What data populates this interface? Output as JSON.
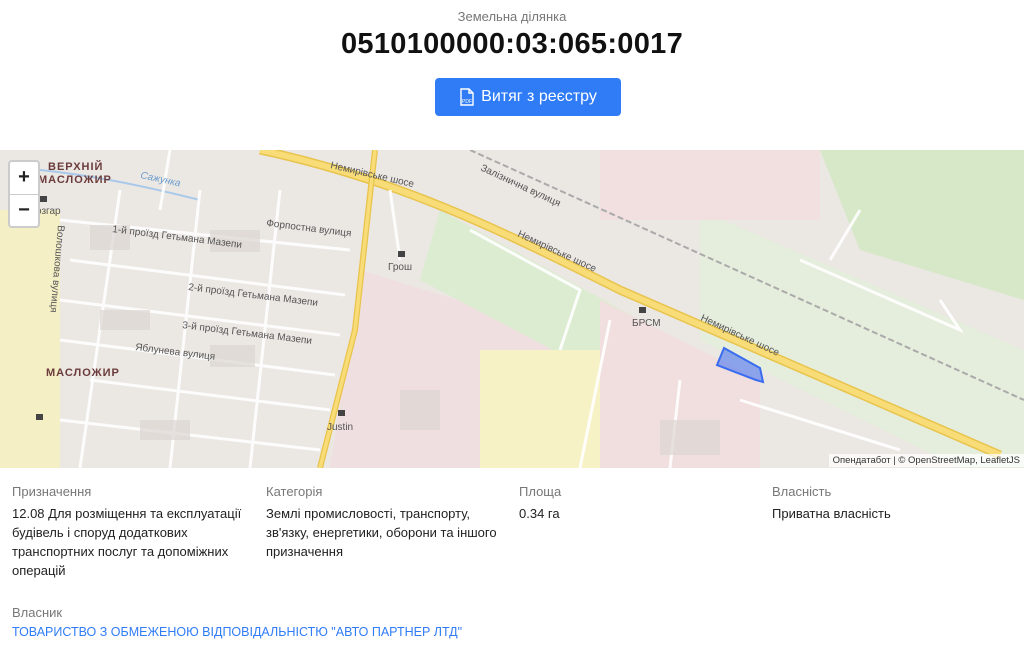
{
  "header": {
    "subtitle": "Земельна ділянка",
    "cadastral_number": "0510100000:03:065:0017",
    "pdf_button_label": "Витяг з реєстру"
  },
  "map": {
    "zoom_in": "+",
    "zoom_out": "−",
    "attribution": "Опендатабот | © OpenStreetMap, LeafletJS",
    "labels": {
      "district1_line1": "ВЕРХНІЙ",
      "district1_line2": "МАСЛОЖИР",
      "district2": "МАСЛОЖИР",
      "river": "Сажунка",
      "road1": "Немирівське шосе",
      "road2": "Немирівське шосе",
      "road3": "Немирівське шосе",
      "rail": "Залізнична вулиця",
      "street1": "1-й проїзд Гетьмана Мазепи",
      "street2": "2-й проїзд Гетьмана Мазепи",
      "street3": "3-й проїзд Гетьмана Мазепи",
      "street4": "Яблунева вулиця",
      "street5": "Форпостна вулиця",
      "street6": "Волошкова вулиця",
      "poi1": "Грош",
      "poi2": "БРСМ",
      "poi3": "Justin",
      "poi4": "озгар"
    },
    "parcel_color": "#3a6cf0"
  },
  "details": {
    "purpose_label": "Призначення",
    "purpose_value": "12.08 Для розміщення та експлуатації будівель і споруд додаткових транспортних послуг та допоміжних операцій",
    "category_label": "Категорія",
    "category_value": "Землі промисловості, транспорту, зв'язку, енергетики, оборони та іншого призначення",
    "area_label": "Площа",
    "area_value": "0.34 га",
    "ownership_label": "Власність",
    "ownership_value": "Приватна власність",
    "owner_label": "Власник",
    "owner_value": "ТОВАРИСТВО З ОБМЕЖЕНОЮ ВІДПОВІДАЛЬНІСТЮ \"АВТО ПАРТНЕР ЛТД\""
  }
}
